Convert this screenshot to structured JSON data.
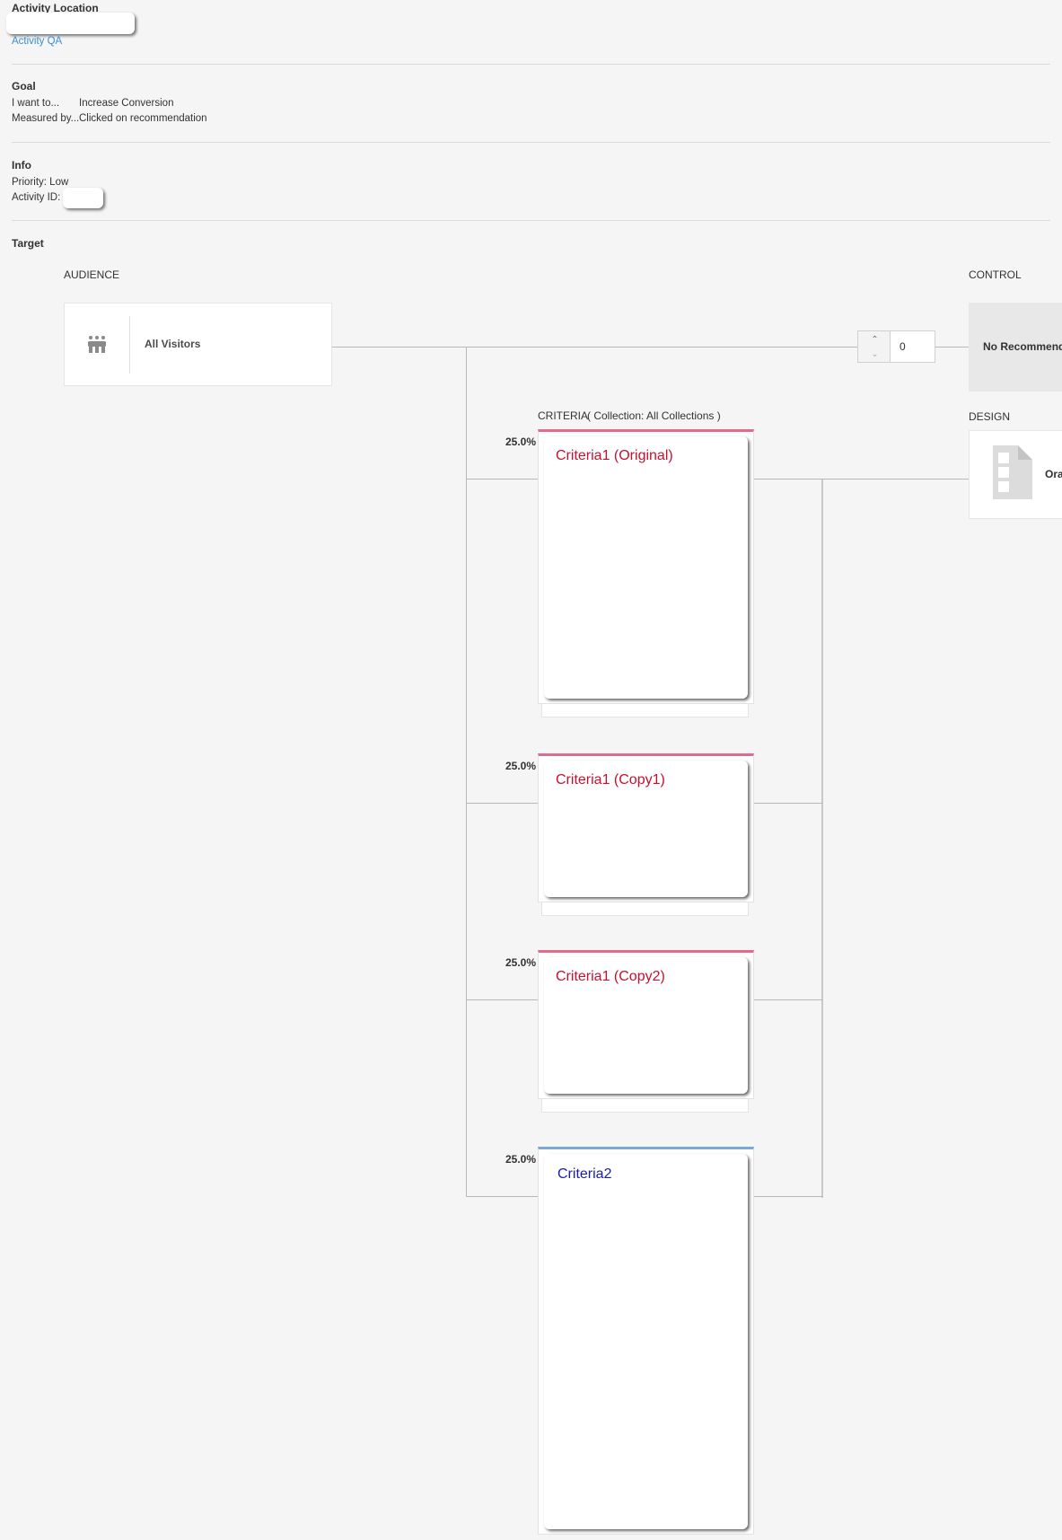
{
  "activity_location": {
    "heading": "Activity Location",
    "link": "Activity QA"
  },
  "goal": {
    "heading": "Goal",
    "want_label": "I want to...",
    "want_value": "Increase Conversion",
    "measured_label": "Measured by...",
    "measured_value": "Clicked on recommendation"
  },
  "info": {
    "heading": "Info",
    "priority": "Priority: Low",
    "activity_id_label": "Activity ID:"
  },
  "target": {
    "heading": "Target"
  },
  "audience": {
    "column_label": "AUDIENCE",
    "name": "All Visitors",
    "icon": "people-group-icon"
  },
  "control": {
    "column_label": "CONTROL",
    "percent": "0",
    "box_text": "No Recommend"
  },
  "criteria": {
    "column_label": "CRITERIA",
    "collection_label": "( Collection: All Collections )",
    "items": [
      {
        "name": "Criteria1 (Original)",
        "percent": "25.0%",
        "accent": "#e06c8c",
        "title_color": "#c8102e"
      },
      {
        "name": "Criteria1 (Copy1)",
        "percent": "25.0%",
        "accent": "#e06c8c",
        "title_color": "#c8102e"
      },
      {
        "name": "Criteria1 (Copy2)",
        "percent": "25.0%",
        "accent": "#e06c8c",
        "title_color": "#c8102e"
      },
      {
        "name": "Criteria2",
        "percent": "25.0%",
        "accent": "#7aa7e0",
        "title_color": "#1a1ab0"
      }
    ]
  },
  "design": {
    "column_label": "DESIGN",
    "name": "Ora",
    "icon": "document-icon"
  }
}
